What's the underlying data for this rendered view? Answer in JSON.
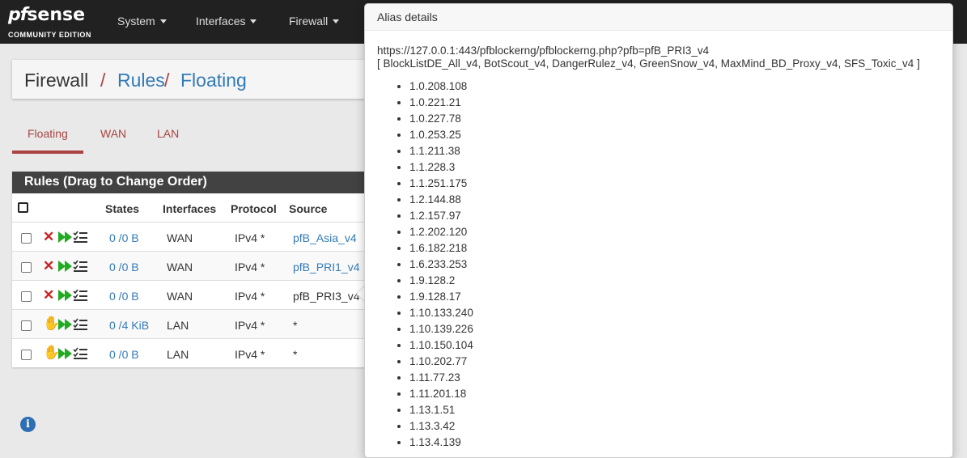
{
  "logo": {
    "brand_pf": "pf",
    "brand_sense": "sense",
    "edition": "COMMUNITY EDITION"
  },
  "nav": [
    {
      "label": "System"
    },
    {
      "label": "Interfaces"
    },
    {
      "label": "Firewall"
    }
  ],
  "breadcrumb": {
    "root": "Firewall",
    "sep": "/",
    "rules": "Rules",
    "current": "Floating"
  },
  "tabs": [
    {
      "label": "Floating",
      "active": true
    },
    {
      "label": "WAN"
    },
    {
      "label": "LAN"
    }
  ],
  "rules_panel": {
    "title": "Rules (Drag to Change Order)",
    "columns": {
      "states": "States",
      "interfaces": "Interfaces",
      "protocol": "Protocol",
      "source": "Source"
    },
    "rows": [
      {
        "action": "block",
        "states": "0 /0 B",
        "interface": "WAN",
        "protocol": "IPv4 *",
        "source": "pfB_Asia_v4"
      },
      {
        "action": "block",
        "states": "0 /0 B",
        "interface": "WAN",
        "protocol": "IPv4 *",
        "source": "pfB_PRI1_v4"
      },
      {
        "action": "block",
        "states": "0 /0 B",
        "interface": "WAN",
        "protocol": "IPv4 *",
        "source": "pfB_PRI3_v4"
      },
      {
        "action": "match",
        "states": "0 /4 KiB",
        "interface": "LAN",
        "protocol": "IPv4 *",
        "source": "*"
      },
      {
        "action": "match",
        "states": "0 /0 B",
        "interface": "LAN",
        "protocol": "IPv4 *",
        "source": "*"
      }
    ]
  },
  "info_icon": "i",
  "popover": {
    "title": "Alias details",
    "url": "https://127.0.0.1:443/pfblockerng/pfblockerng.php?pfb=pfB_PRI3_v4",
    "lists": "[ BlockListDE_All_v4, BotScout_v4, DangerRulez_v4, GreenSnow_v4, MaxMind_BD_Proxy_v4, SFS_Toxic_v4 ]",
    "addresses": [
      "1.0.208.108",
      "1.0.221.21",
      "1.0.227.78",
      "1.0.253.25",
      "1.1.211.38",
      "1.1.228.3",
      "1.1.251.175",
      "1.2.144.88",
      "1.2.157.97",
      "1.2.202.120",
      "1.6.182.218",
      "1.6.233.253",
      "1.9.128.2",
      "1.9.128.17",
      "1.10.133.240",
      "1.10.139.226",
      "1.10.150.104",
      "1.10.202.77",
      "1.11.77.23",
      "1.11.201.18",
      "1.13.1.51",
      "1.13.3.42",
      "1.13.4.139"
    ]
  },
  "colors": {
    "navbar": "#212121",
    "accent_red": "#a94442",
    "link_blue": "#337ab7",
    "block_red": "#cc2222",
    "pass_green": "#22aa22",
    "hand_yellow": "#f0b90e"
  }
}
